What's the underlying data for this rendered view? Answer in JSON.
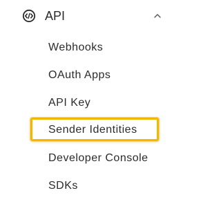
{
  "section": {
    "title": "API",
    "icon": "code-circle-icon",
    "expanded": true,
    "chevron_icon": "chevron-up-icon"
  },
  "items": [
    {
      "label": "Webhooks"
    },
    {
      "label": "OAuth Apps"
    },
    {
      "label": "API Key"
    },
    {
      "label": "Sender Identities",
      "highlighted": true
    },
    {
      "label": "Developer Console"
    },
    {
      "label": "SDKs"
    }
  ],
  "colors": {
    "text": "#2b2b2b",
    "highlight_border": "#f5b800",
    "background": "#ffffff"
  }
}
